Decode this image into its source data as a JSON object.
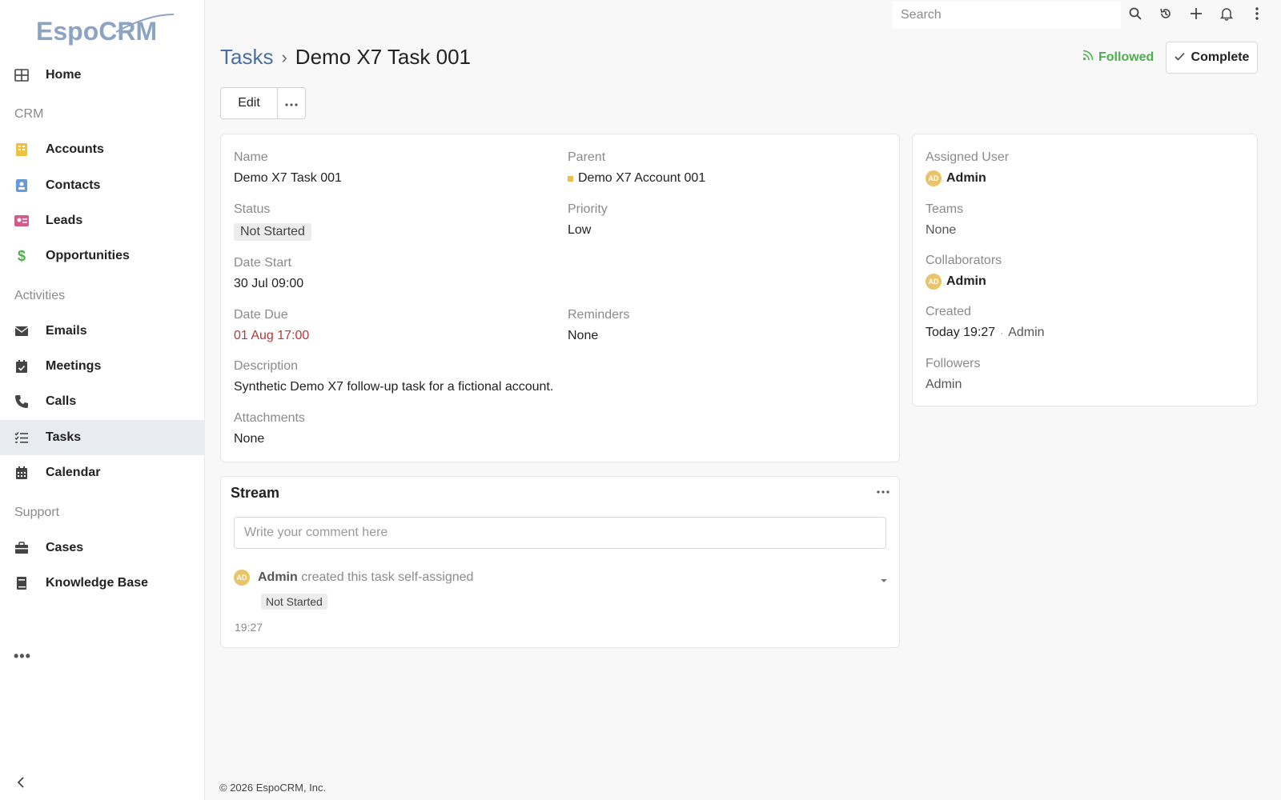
{
  "app": {
    "logo_text": "EspoCRM",
    "footer": "© 2026 EspoCRM, Inc."
  },
  "sidebar": {
    "items": [
      {
        "label": "Home",
        "icon": "home-grid-icon"
      },
      {
        "section": "CRM"
      },
      {
        "label": "Accounts",
        "icon": "building-icon",
        "color": "#f0c040"
      },
      {
        "label": "Contacts",
        "icon": "contact-card-icon",
        "color": "#6a9ad6"
      },
      {
        "label": "Leads",
        "icon": "lead-card-icon",
        "color": "#d45a8a"
      },
      {
        "label": "Opportunities",
        "icon": "dollar-icon",
        "color": "#4cae4c"
      },
      {
        "section": "Activities"
      },
      {
        "label": "Emails",
        "icon": "envelope-icon"
      },
      {
        "label": "Meetings",
        "icon": "calendar-check-icon"
      },
      {
        "label": "Calls",
        "icon": "phone-icon"
      },
      {
        "label": "Tasks",
        "icon": "tasks-list-icon",
        "active": true
      },
      {
        "label": "Calendar",
        "icon": "calendar-icon"
      },
      {
        "section": "Support"
      },
      {
        "label": "Cases",
        "icon": "briefcase-icon"
      },
      {
        "label": "Knowledge Base",
        "icon": "book-icon"
      }
    ],
    "more": "•••"
  },
  "topbar": {
    "search_placeholder": "Search"
  },
  "header": {
    "crumb_parent": "Tasks",
    "crumb_current": "Demo X7 Task 001",
    "followed_label": "Followed",
    "complete_label": "Complete",
    "edit_label": "Edit"
  },
  "record": {
    "name_label": "Name",
    "name_value": "Demo X7 Task 001",
    "parent_label": "Parent",
    "parent_value": "Demo X7 Account 001",
    "status_label": "Status",
    "status_value": "Not Started",
    "priority_label": "Priority",
    "priority_value": "Low",
    "date_start_label": "Date Start",
    "date_start_value": "30 Jul 09:00",
    "date_due_label": "Date Due",
    "date_due_value": "01 Aug 17:00",
    "reminders_label": "Reminders",
    "reminders_value": "None",
    "description_label": "Description",
    "description_value": "Synthetic Demo X7 follow-up task for a fictional account.",
    "attachments_label": "Attachments",
    "attachments_value": "None"
  },
  "side_panel": {
    "assigned_label": "Assigned User",
    "assigned_value": "Admin",
    "assigned_initials": "AD",
    "teams_label": "Teams",
    "teams_value": "None",
    "collaborators_label": "Collaborators",
    "collaborators_value": "Admin",
    "collaborators_initials": "AD",
    "created_label": "Created",
    "created_value": "Today 19:27",
    "created_sep": "·",
    "created_by": "Admin",
    "followers_label": "Followers",
    "followers_value": "Admin"
  },
  "stream": {
    "title": "Stream",
    "comment_placeholder": "Write your comment here",
    "note": {
      "initials": "AD",
      "user": "Admin",
      "text": "created this task self-assigned",
      "badge": "Not Started",
      "time": "19:27"
    }
  },
  "colors": {
    "accent": "#4a6fa5",
    "followed": "#4cae4c",
    "due_overdue": "#b03a3a",
    "avatar": "#e8c46a"
  }
}
